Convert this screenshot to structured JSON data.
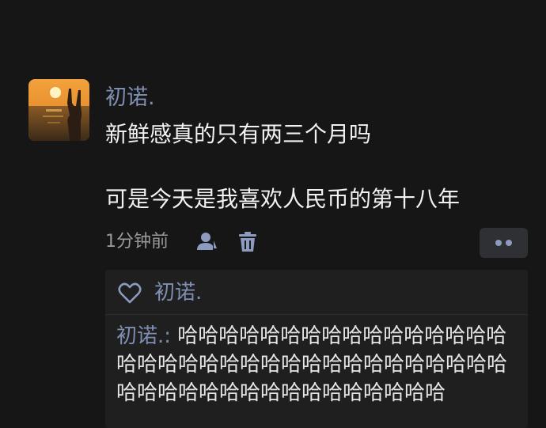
{
  "post": {
    "username": "初诺.",
    "lines": [
      "新鲜感真的只有两三个月吗",
      "可是今天是我喜欢人民币的第十八年"
    ],
    "time": "1分钟前"
  },
  "likes": {
    "username": "初诺."
  },
  "reply": {
    "author": "初诺.:",
    "text": " 哈哈哈哈哈哈哈哈哈哈哈哈哈哈哈哈哈哈哈哈哈哈哈哈哈哈哈哈哈哈哈哈哈哈哈哈哈哈哈哈哈哈哈哈哈哈哈哈哈哈哈"
  },
  "icons": {
    "avatar": "sunset-silhouette-avatar",
    "user": "user-icon",
    "trash": "trash-icon",
    "more": "more-dots-icon",
    "heart": "heart-icon"
  },
  "colors": {
    "background": "#161616",
    "panel": "#1f1f1f",
    "username": "#7f8fb3",
    "text": "#f2f2f2",
    "meta": "#9a9a9a",
    "icon": "#8c9bbf"
  }
}
